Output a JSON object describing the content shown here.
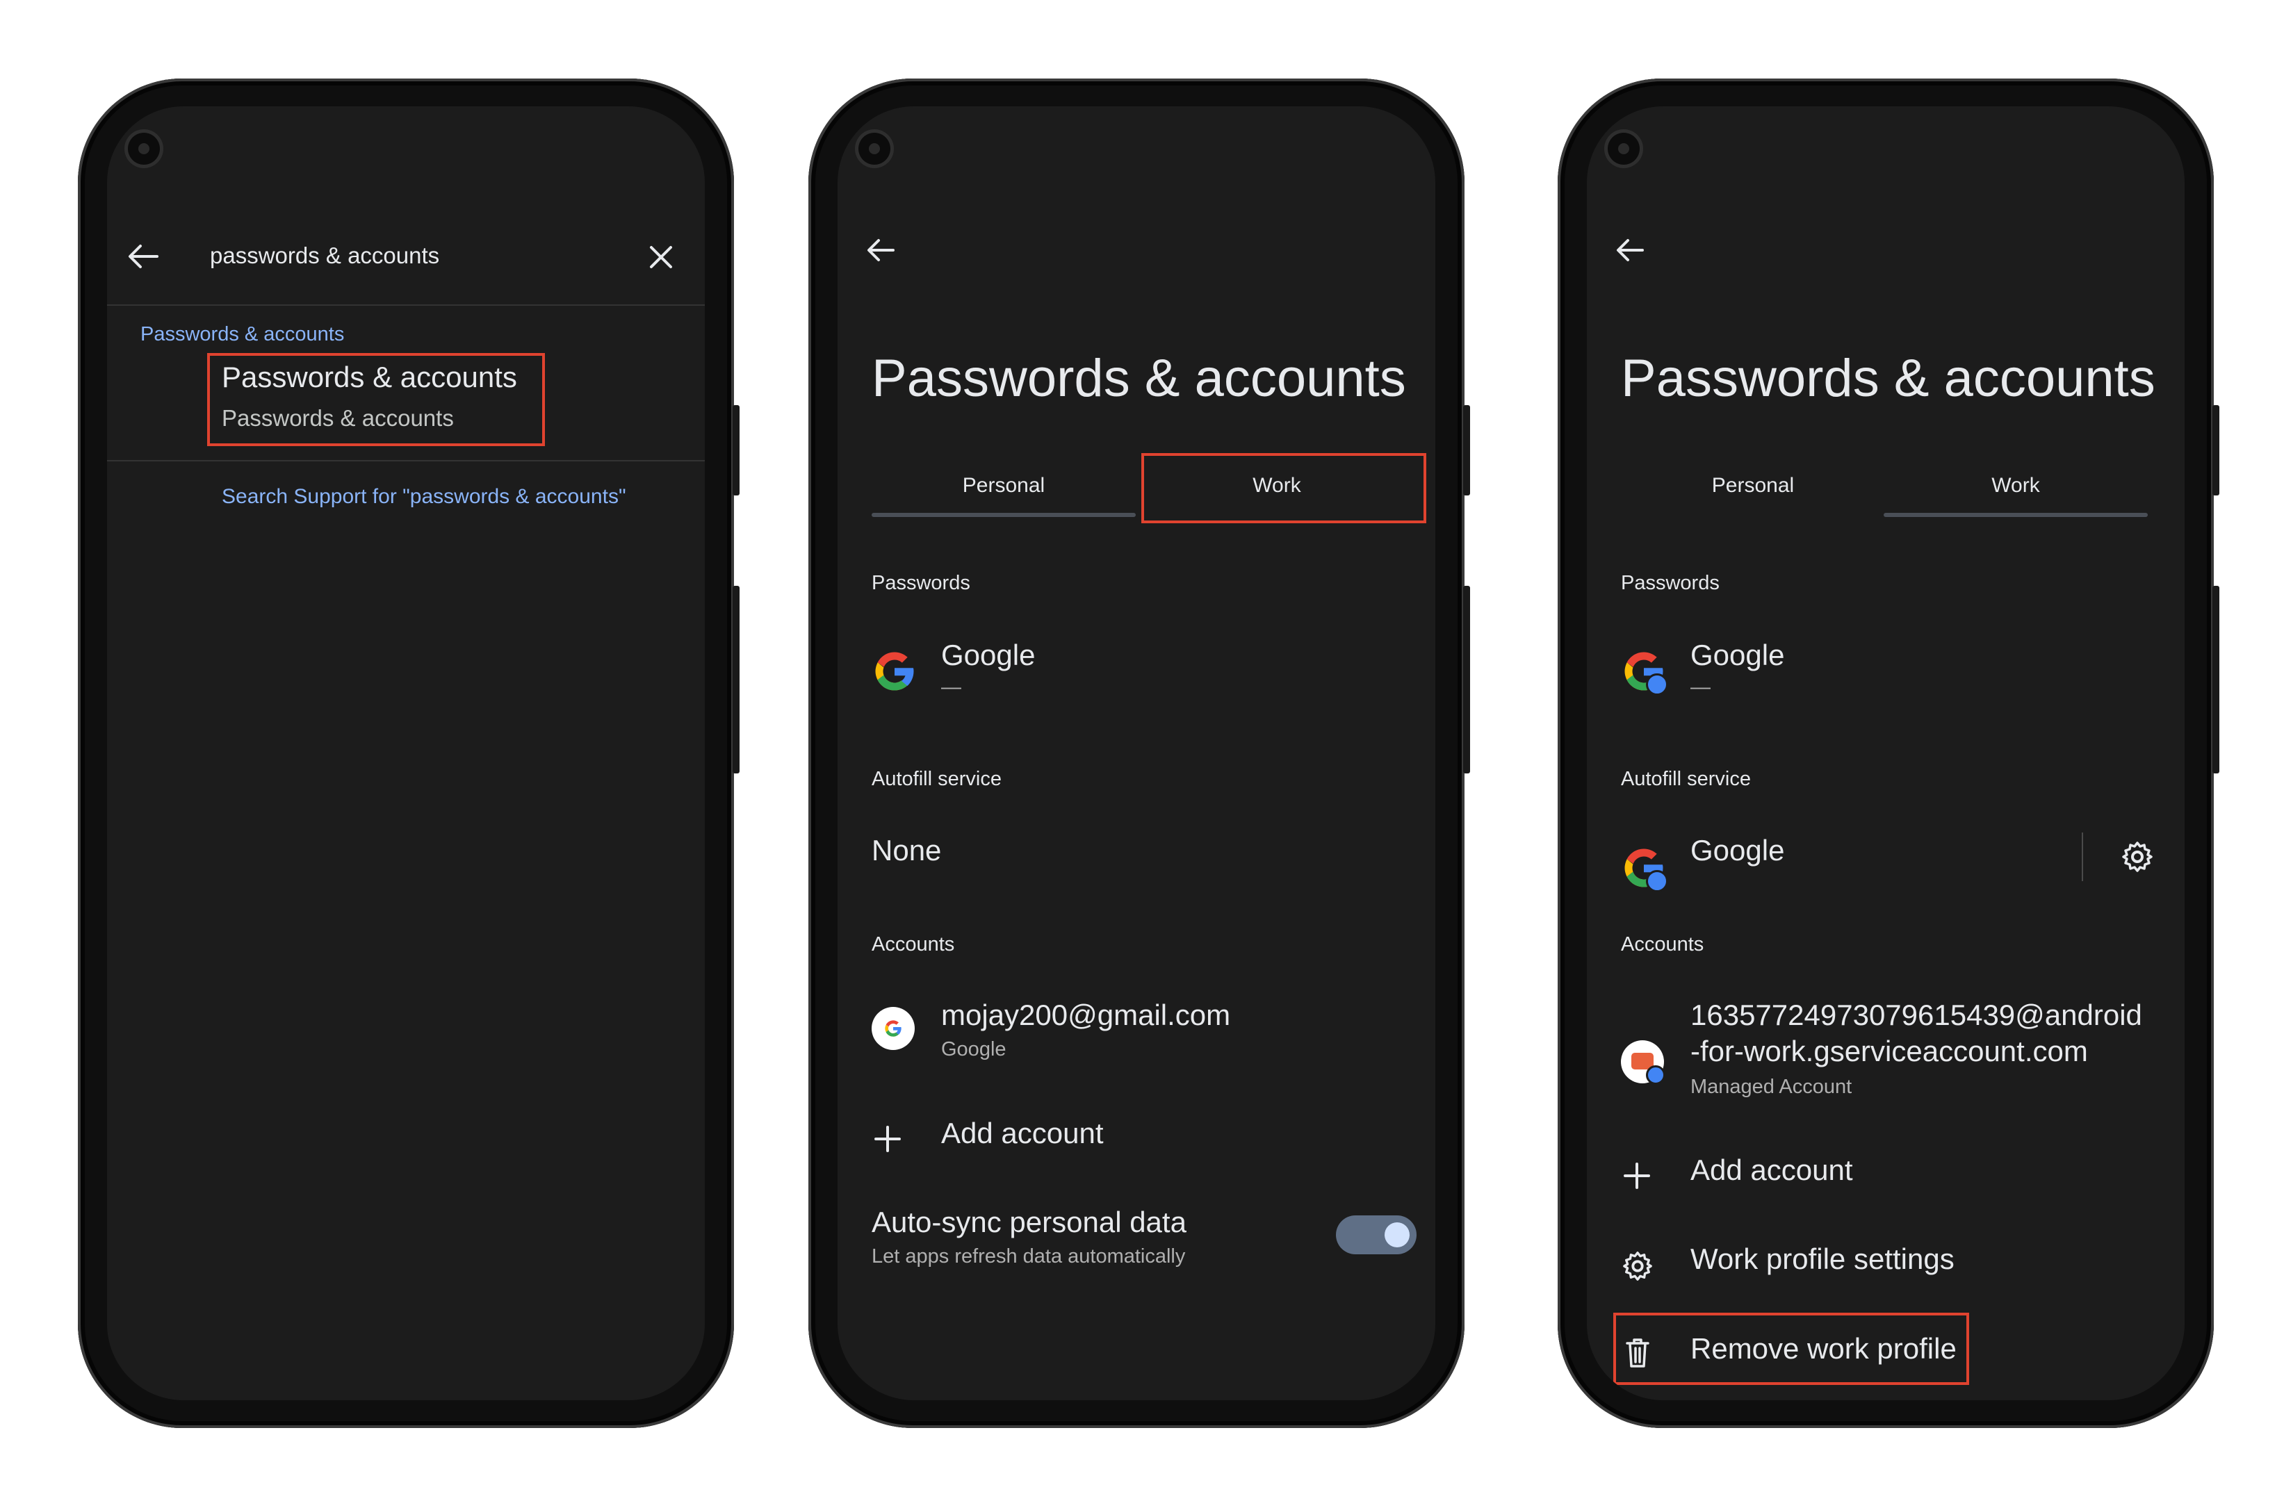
{
  "phone1": {
    "search_query": "passwords & accounts",
    "result_category": "Passwords & accounts",
    "result_title": "Passwords & accounts",
    "result_subtitle": "Passwords & accounts",
    "support_link": "Search Support for \"passwords & accounts\""
  },
  "phone2": {
    "title": "Passwords & accounts",
    "tabs": [
      "Personal",
      "Work"
    ],
    "passwords_header": "Passwords",
    "password_app": "Google",
    "password_app_sub": "—",
    "autofill_header": "Autofill service",
    "autofill_value": "None",
    "accounts_header": "Accounts",
    "account_email": "mojay200@gmail.com",
    "account_type": "Google",
    "add_account": "Add account",
    "autosync_title": "Auto-sync personal data",
    "autosync_sub": "Let apps refresh data automatically"
  },
  "phone3": {
    "title": "Passwords & accounts",
    "tabs": [
      "Personal",
      "Work"
    ],
    "passwords_header": "Passwords",
    "password_app": "Google",
    "password_app_sub": "—",
    "autofill_header": "Autofill service",
    "autofill_value": "Google",
    "accounts_header": "Accounts",
    "account_line1": "16357724973079615439@android",
    "account_line2": "-for-work.gserviceaccount.com",
    "account_type": "Managed Account",
    "add_account": "Add account",
    "work_profile_settings": "Work profile settings",
    "remove_work_profile": "Remove work profile"
  },
  "colors": {
    "screen_bg": "#1c1c1c",
    "accent_blue": "#8ab4f8",
    "highlight": "#e0432f",
    "toggle_track": "#5f6f86",
    "toggle_thumb": "#d3e3fd"
  }
}
